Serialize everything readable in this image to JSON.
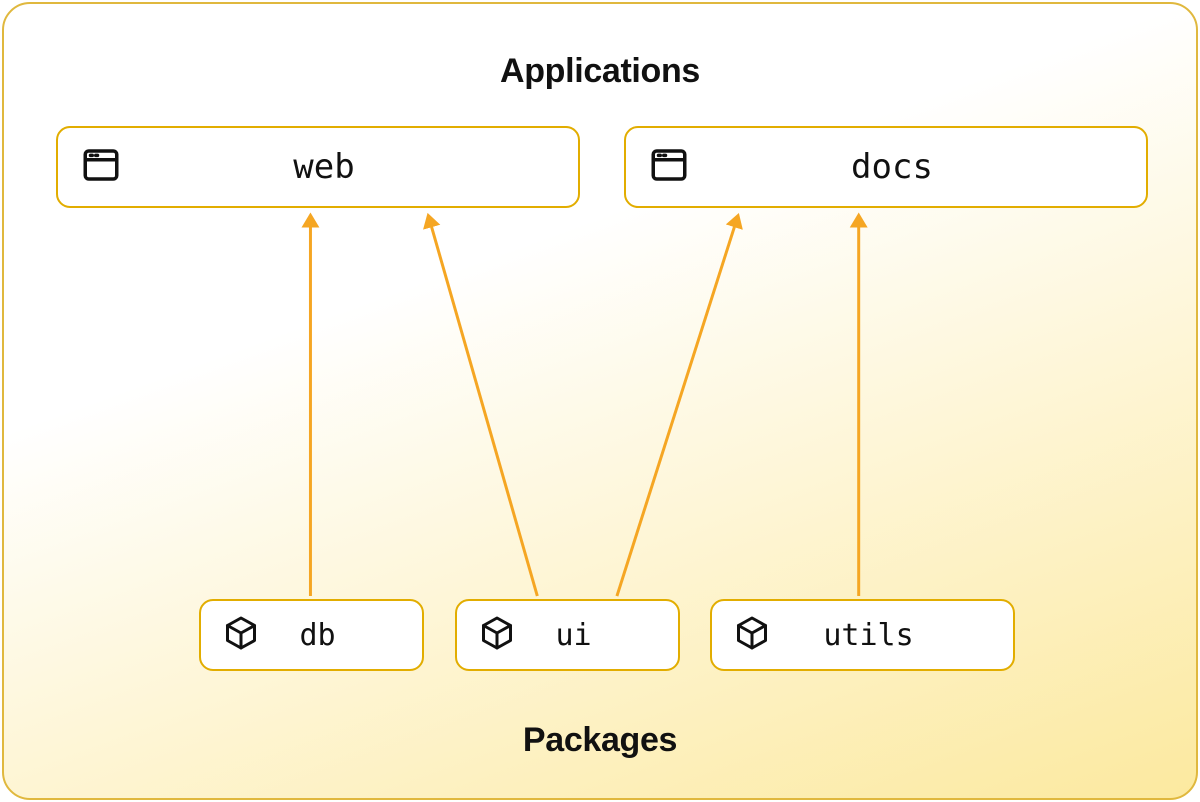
{
  "sections": {
    "top_title": "Applications",
    "bottom_title": "Packages"
  },
  "applications": [
    {
      "id": "web",
      "label": "web"
    },
    {
      "id": "docs",
      "label": "docs"
    }
  ],
  "packages": [
    {
      "id": "db",
      "label": "db"
    },
    {
      "id": "ui",
      "label": "ui"
    },
    {
      "id": "utils",
      "label": "utils"
    }
  ],
  "edges": [
    {
      "from": "db",
      "to": "web"
    },
    {
      "from": "ui",
      "to": "web"
    },
    {
      "from": "ui",
      "to": "docs"
    },
    {
      "from": "utils",
      "to": "docs"
    }
  ],
  "colors": {
    "node_border": "#e2ad00",
    "arrow": "#f5a623"
  },
  "icons": {
    "app": "window-icon",
    "pkg": "package-icon"
  }
}
